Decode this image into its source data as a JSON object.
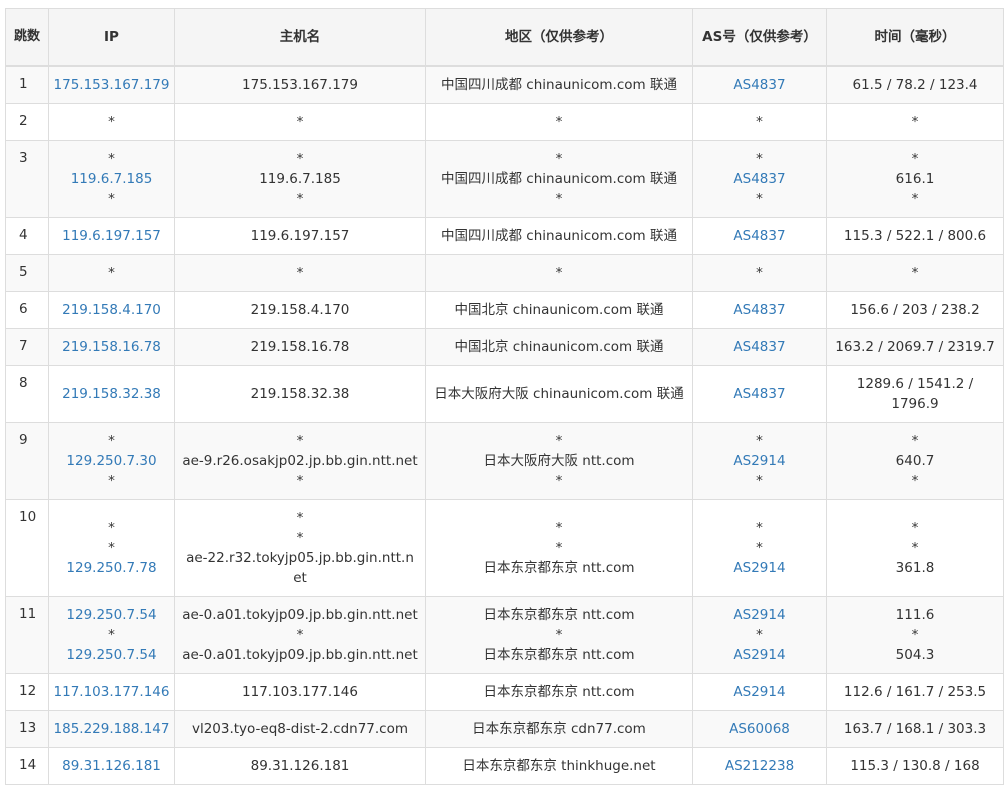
{
  "headers": {
    "hop": "跳数",
    "ip": "IP",
    "hostname": "主机名",
    "location": "地区（仅供参考）",
    "as": "AS号（仅供参考）",
    "time": "时间（毫秒）"
  },
  "rows": [
    {
      "hop": "1",
      "ip": [
        "175.153.167.179"
      ],
      "host": [
        "175.153.167.179"
      ],
      "loc": [
        "中国四川成都 chinaunicom.com 联通"
      ],
      "as": [
        "AS4837"
      ],
      "time": [
        "61.5 / 78.2 / 123.4"
      ]
    },
    {
      "hop": "2",
      "ip": [
        "*"
      ],
      "host": [
        "*"
      ],
      "loc": [
        "*"
      ],
      "as": [
        "*"
      ],
      "time": [
        "*"
      ]
    },
    {
      "hop": "3",
      "ip": [
        "*",
        "119.6.7.185",
        "*"
      ],
      "host": [
        "*",
        "119.6.7.185",
        "*"
      ],
      "loc": [
        "*",
        "中国四川成都 chinaunicom.com 联通",
        "*"
      ],
      "as": [
        "*",
        "AS4837",
        "*"
      ],
      "time": [
        "*",
        "616.1",
        "*"
      ]
    },
    {
      "hop": "4",
      "ip": [
        "119.6.197.157"
      ],
      "host": [
        "119.6.197.157"
      ],
      "loc": [
        "中国四川成都 chinaunicom.com 联通"
      ],
      "as": [
        "AS4837"
      ],
      "time": [
        "115.3 / 522.1 / 800.6"
      ]
    },
    {
      "hop": "5",
      "ip": [
        "*"
      ],
      "host": [
        "*"
      ],
      "loc": [
        "*"
      ],
      "as": [
        "*"
      ],
      "time": [
        "*"
      ]
    },
    {
      "hop": "6",
      "ip": [
        "219.158.4.170"
      ],
      "host": [
        "219.158.4.170"
      ],
      "loc": [
        "中国北京 chinaunicom.com 联通"
      ],
      "as": [
        "AS4837"
      ],
      "time": [
        "156.6 / 203 / 238.2"
      ]
    },
    {
      "hop": "7",
      "ip": [
        "219.158.16.78"
      ],
      "host": [
        "219.158.16.78"
      ],
      "loc": [
        "中国北京 chinaunicom.com 联通"
      ],
      "as": [
        "AS4837"
      ],
      "time": [
        "163.2 / 2069.7 / 2319.7"
      ]
    },
    {
      "hop": "8",
      "ip": [
        "219.158.32.38"
      ],
      "host": [
        "219.158.32.38"
      ],
      "loc": [
        "日本大阪府大阪 chinaunicom.com 联通"
      ],
      "as": [
        "AS4837"
      ],
      "time": [
        "1289.6 / 1541.2 / 1796.9"
      ]
    },
    {
      "hop": "9",
      "ip": [
        "*",
        "129.250.7.30",
        "*"
      ],
      "host": [
        "*",
        "ae-9.r26.osakjp02.jp.bb.gin.ntt.net",
        "*"
      ],
      "loc": [
        "*",
        "日本大阪府大阪 ntt.com",
        "*"
      ],
      "as": [
        "*",
        "AS2914",
        "*"
      ],
      "time": [
        "*",
        "640.7",
        "*"
      ]
    },
    {
      "hop": "10",
      "ip": [
        "*",
        "*",
        "129.250.7.78"
      ],
      "host": [
        "*",
        "*",
        "ae-22.r32.tokyjp05.jp.bb.gin.ntt.net"
      ],
      "loc": [
        "*",
        "*",
        "日本东京都东京 ntt.com"
      ],
      "as": [
        "*",
        "*",
        "AS2914"
      ],
      "time": [
        "*",
        "*",
        "361.8"
      ]
    },
    {
      "hop": "11",
      "ip": [
        "129.250.7.54",
        "*",
        "129.250.7.54"
      ],
      "host": [
        "ae-0.a01.tokyjp09.jp.bb.gin.ntt.net",
        "*",
        "ae-0.a01.tokyjp09.jp.bb.gin.ntt.net"
      ],
      "loc": [
        "日本东京都东京 ntt.com",
        "*",
        "日本东京都东京 ntt.com"
      ],
      "as": [
        "AS2914",
        "*",
        "AS2914"
      ],
      "time": [
        "111.6",
        "*",
        "504.3"
      ]
    },
    {
      "hop": "12",
      "ip": [
        "117.103.177.146"
      ],
      "host": [
        "117.103.177.146"
      ],
      "loc": [
        "日本东京都东京 ntt.com"
      ],
      "as": [
        "AS2914"
      ],
      "time": [
        "112.6 / 161.7 / 253.5"
      ]
    },
    {
      "hop": "13",
      "ip": [
        "185.229.188.147"
      ],
      "host": [
        "vl203.tyo-eq8-dist-2.cdn77.com"
      ],
      "loc": [
        "日本东京都东京 cdn77.com"
      ],
      "as": [
        "AS60068"
      ],
      "time": [
        "163.7 / 168.1 / 303.3"
      ]
    },
    {
      "hop": "14",
      "ip": [
        "89.31.126.181"
      ],
      "host": [
        "89.31.126.181"
      ],
      "loc": [
        "日本东京都东京 thinkhuge.net"
      ],
      "as": [
        "AS212238"
      ],
      "time": [
        "115.3 / 130.8 / 168"
      ]
    }
  ]
}
